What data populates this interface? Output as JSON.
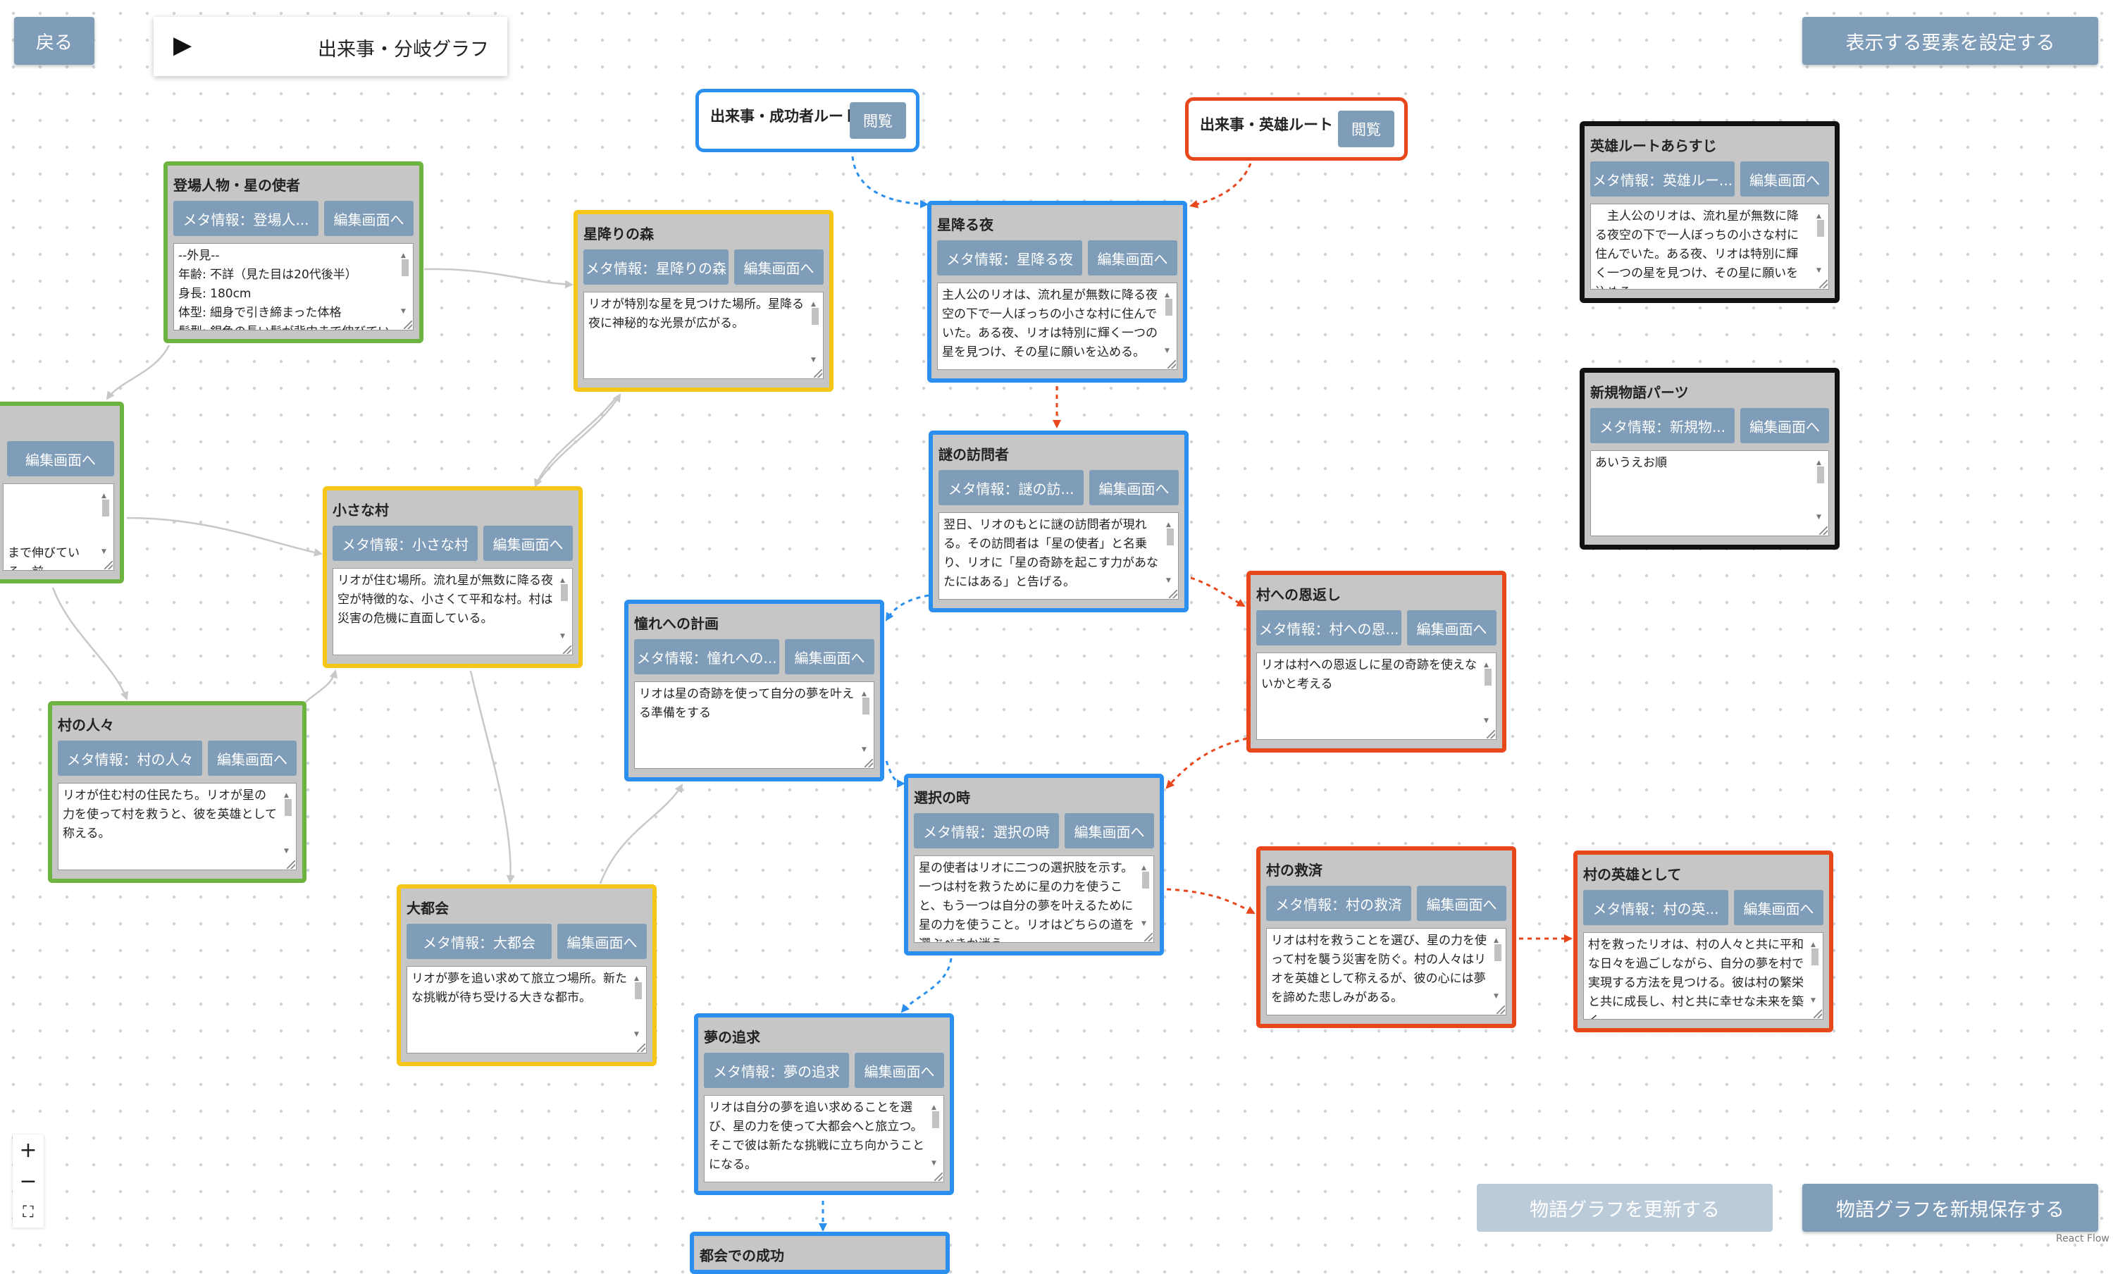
{
  "toolbar": {
    "back_label": "戻る",
    "graph_title": "出来事・分岐グラフ",
    "play_icon": "▶",
    "settings_label": "表示する要素を設定する",
    "update_label": "物語グラフを更新する",
    "save_new_label": "物語グラフを新規保存する",
    "attribution": "React Flow"
  },
  "zoom_controls": {
    "zoom_in": "+",
    "zoom_out": "−",
    "fit_view": "⛶"
  },
  "colors": {
    "character": "#6db33f",
    "place": "#f5c518",
    "event": "#2b8ff0",
    "hero": "#e8471c",
    "note": "#111111",
    "button": "#7f9db8",
    "node_bg": "#c6c6c6"
  },
  "routes": [
    {
      "title": "出来事・成功者ルート",
      "button": "閲覧",
      "kind": "event"
    },
    {
      "title": "出来事・英雄ルート",
      "button": "閲覧",
      "kind": "hero"
    }
  ],
  "nodes": [
    {
      "id": "star_messenger",
      "kind": "character",
      "title": "登場人物・星の使者",
      "meta": "メタ情報：登場人...",
      "edit": "編集画面へ",
      "text": "--外見--\n年齢: 不詳（見た目は20代後半）\n身長: 180cm\n体型: 細身で引き締まった体格\n髪型: 銀色の長い髪が背中まで伸びている。"
    },
    {
      "id": "partial_char",
      "kind": "character",
      "title": "",
      "meta": "",
      "edit": "編集画面へ",
      "text": "\n\n\nまで伸びている。前"
    },
    {
      "id": "villagers",
      "kind": "character",
      "title": "村の人々",
      "meta": "メタ情報：村の人々",
      "edit": "編集画面へ",
      "text": "リオが住む村の住民たち。リオが星の力を使って村を救うと、彼を英雄として称える。"
    },
    {
      "id": "forest",
      "kind": "place",
      "title": "星降りの森",
      "meta": "メタ情報：星降りの森",
      "edit": "編集画面へ",
      "text": "リオが特別な星を見つけた場所。星降る夜に神秘的な光景が広がる。"
    },
    {
      "id": "village",
      "kind": "place",
      "title": "小さな村",
      "meta": "メタ情報：小さな村",
      "edit": "編集画面へ",
      "text": "リオが住む場所。流れ星が無数に降る夜空が特徴的な、小さくて平和な村。村は災害の危機に直面している。"
    },
    {
      "id": "city",
      "kind": "place",
      "title": "大都会",
      "meta": "メタ情報：大都会",
      "edit": "編集画面へ",
      "text": "リオが夢を追い求めて旅立つ場所。新たな挑戦が待ち受ける大きな都市。"
    },
    {
      "id": "starry_night",
      "kind": "event",
      "title": "星降る夜",
      "meta": "メタ情報：星降る夜",
      "edit": "編集画面へ",
      "text": "主人公のリオは、流れ星が無数に降る夜空の下で一人ぼっちの小さな村に住んでいた。ある夜、リオは特別に輝く一つの星を見つけ、その星に願いを込める。"
    },
    {
      "id": "visitor",
      "kind": "event",
      "title": "謎の訪問者",
      "meta": "メタ情報：謎の訪...",
      "edit": "編集画面へ",
      "text": "翌日、リオのもとに謎の訪問者が現れる。その訪問者は「星の使者」と名乗り、リオに「星の奇跡を起こす力があなたにはある」と告げる。"
    },
    {
      "id": "plan",
      "kind": "event",
      "title": "憧れへの計画",
      "meta": "メタ情報：憧れへの...",
      "edit": "編集画面へ",
      "text": "リオは星の奇跡を使って自分の夢を叶える準備をする"
    },
    {
      "id": "choice",
      "kind": "event",
      "title": "選択の時",
      "meta": "メタ情報：選択の時",
      "edit": "編集画面へ",
      "text": "星の使者はリオに二つの選択肢を示す。一つは村を救うために星の力を使うこと、もう一つは自分の夢を叶えるために星の力を使うこと。リオはどちらの道を選ぶべきか迷う。"
    },
    {
      "id": "dream",
      "kind": "event",
      "title": "夢の追求",
      "meta": "メタ情報：夢の追求",
      "edit": "編集画面へ",
      "text": "リオは自分の夢を追い求めることを選び、星の力を使って大都会へと旅立つ。そこで彼は新たな挑戦に立ち向かうことになる。"
    },
    {
      "id": "partial_event",
      "kind": "event",
      "title": "都会での成功",
      "meta": "",
      "edit": "",
      "text": ""
    },
    {
      "id": "repay",
      "kind": "hero",
      "title": "村への恩返し",
      "meta": "メタ情報：村への恩...",
      "edit": "編集画面へ",
      "text": "リオは村への恩返しに星の奇跡を使えないかと考える"
    },
    {
      "id": "rescue",
      "kind": "hero",
      "title": "村の救済",
      "meta": "メタ情報：村の救済",
      "edit": "編集画面へ",
      "text": "リオは村を救うことを選び、星の力を使って村を襲う災害を防ぐ。村の人々はリオを英雄として称えるが、彼の心には夢を諦めた悲しみがある。"
    },
    {
      "id": "as_hero",
      "kind": "hero",
      "title": "村の英雄として",
      "meta": "メタ情報：村の英...",
      "edit": "編集画面へ",
      "text": "村を救ったリオは、村の人々と共に平和な日々を過ごしながら、自分の夢を村で実現する方法を見つける。彼は村の繁栄と共に成長し、村と共に幸せな未来を築く。"
    },
    {
      "id": "synopsis",
      "kind": "note",
      "title": "英雄ルートあらすじ",
      "meta": "メタ情報：英雄ルー...",
      "edit": "編集画面へ",
      "text": "　主人公のリオは、流れ星が無数に降る夜空の下で一人ぼっちの小さな村に住んでいた。ある夜、リオは特別に輝く一つの星を見つけ、その星に願いを込める。\n　翌日、リオのもとに謎の訪問者が現れる。"
    },
    {
      "id": "new_parts",
      "kind": "note",
      "title": "新規物語パーツ",
      "meta": "メタ情報：新規物...",
      "edit": "編集画面へ",
      "text": "あいうえお順"
    }
  ]
}
